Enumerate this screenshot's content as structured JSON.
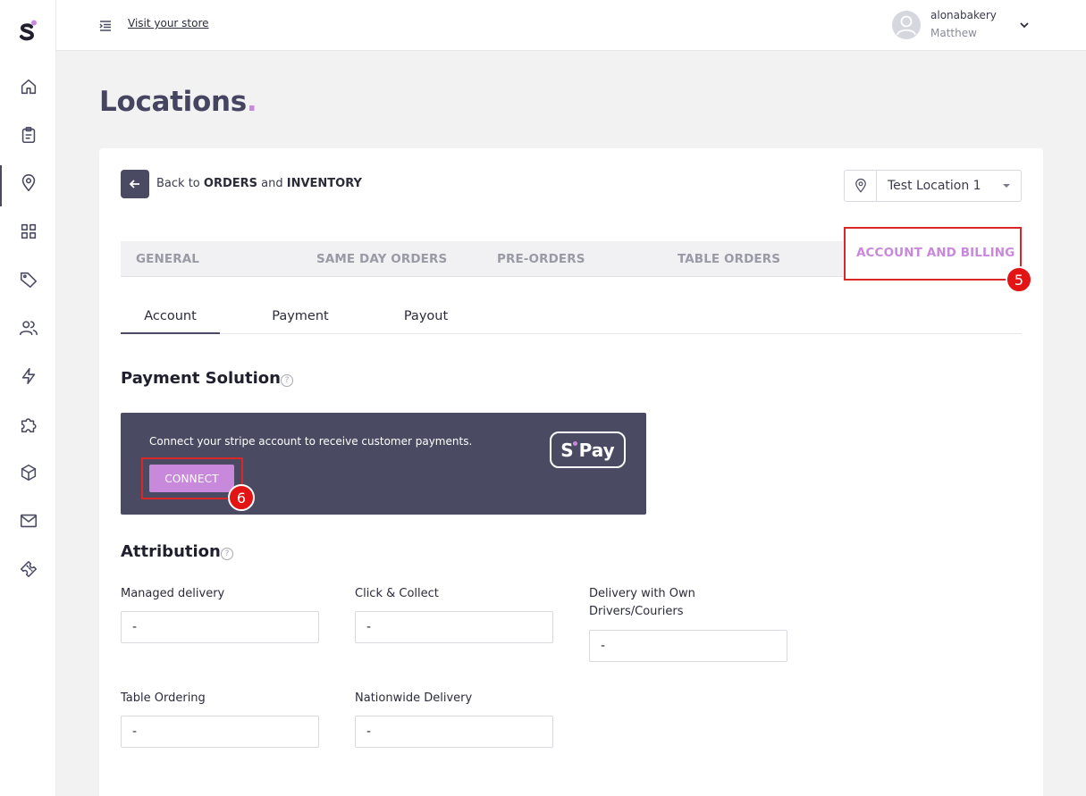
{
  "topbar": {
    "visit_store": "Visit your store",
    "user_name": "alonabakery",
    "user_sub": "Matthew"
  },
  "sidebar": {
    "items": [
      "home-icon",
      "clipboard-icon",
      "location-pin-icon",
      "grid-icon",
      "tag-icon",
      "users-icon",
      "lightning-icon",
      "puzzle-icon",
      "box-icon",
      "mail-icon",
      "ticket-icon"
    ],
    "active": "location-pin-icon"
  },
  "page": {
    "title": "Locations",
    "title_dot": "."
  },
  "back": {
    "prefix": "Back to ",
    "orders": "ORDERS",
    "and": " and ",
    "inventory": "INVENTORY"
  },
  "location_select": {
    "value": "Test Location 1"
  },
  "main_tabs": [
    "GENERAL",
    "SAME DAY ORDERS",
    "PRE-ORDERS",
    "TABLE ORDERS",
    "ACCOUNT AND BILLING"
  ],
  "main_tabs_active": "ACCOUNT AND BILLING",
  "sub_tabs": [
    "Account",
    "Payment",
    "Payout"
  ],
  "sub_tabs_active": "Account",
  "payment_solution": {
    "title": "Payment Solution",
    "text": "Connect your stripe account to receive customer payments.",
    "connect_label": "CONNECT",
    "logo_text": "Pay"
  },
  "attribution": {
    "title": "Attribution",
    "fields": [
      {
        "label": "Managed delivery",
        "value": "-"
      },
      {
        "label": "Click & Collect",
        "value": "-"
      },
      {
        "label": "Delivery with Own Drivers/Couriers",
        "value": "-"
      },
      {
        "label": "Table Ordering",
        "value": "-"
      },
      {
        "label": "Nationwide Delivery",
        "value": "-"
      }
    ]
  },
  "annotations": {
    "badge_5": "5",
    "badge_6": "6"
  },
  "colors": {
    "accent": "#c889dd",
    "primary_dark": "#4a4a63",
    "annotation_red": "#e31414"
  }
}
